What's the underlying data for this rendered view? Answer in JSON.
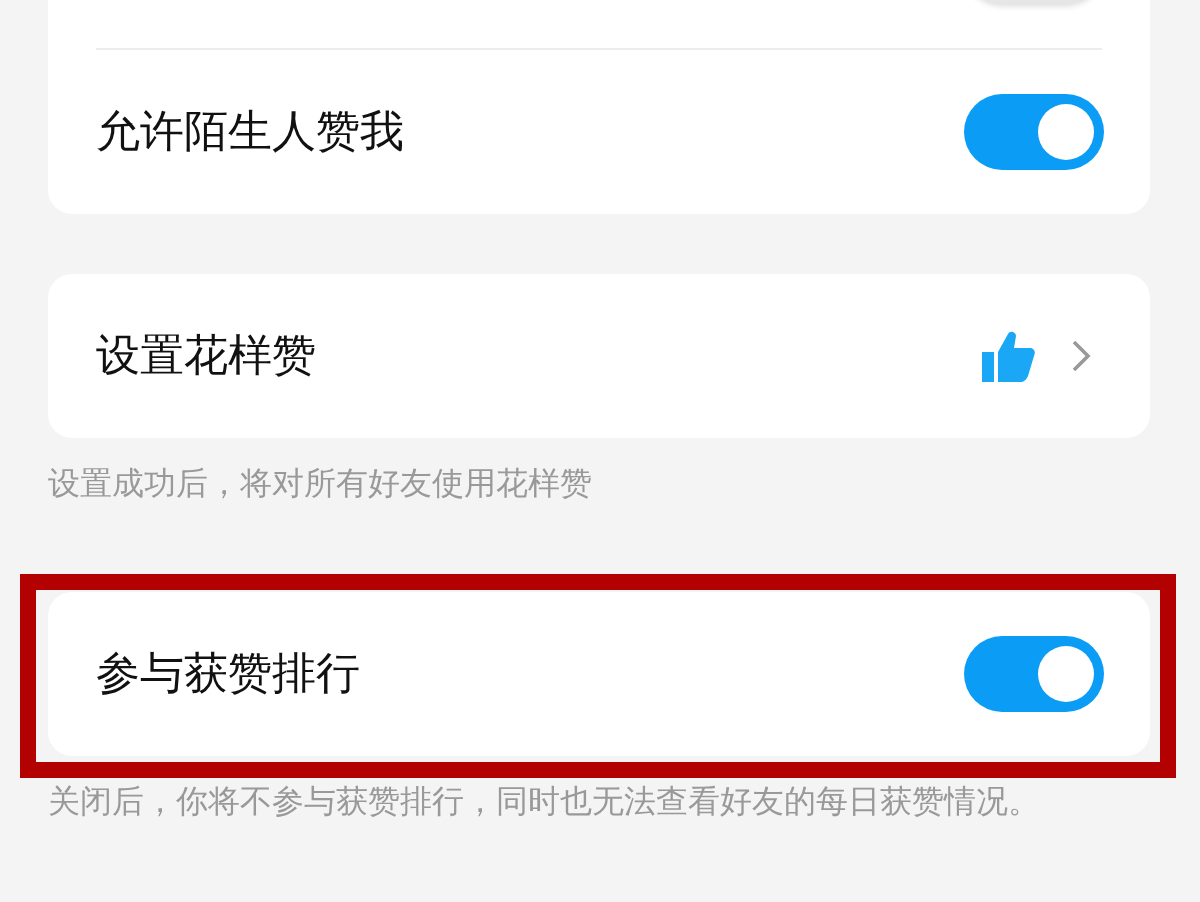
{
  "sections": [
    {
      "highlighted": false,
      "rows": [
        {
          "kind": "toggle",
          "on": false
        },
        {
          "kind": "toggle",
          "label": "允许陌生人赞我",
          "on": true
        }
      ]
    },
    {
      "highlighted": false,
      "rows": [
        {
          "kind": "link",
          "label": "设置花样赞"
        }
      ],
      "caption": "设置成功后，将对所有好友使用花样赞"
    },
    {
      "highlighted": true,
      "rows": [
        {
          "kind": "toggle",
          "label": "参与获赞排行",
          "on": true
        }
      ],
      "caption": "关闭后，你将不参与获赞排行，同时也无法查看好友的每日获赞情况。"
    }
  ]
}
